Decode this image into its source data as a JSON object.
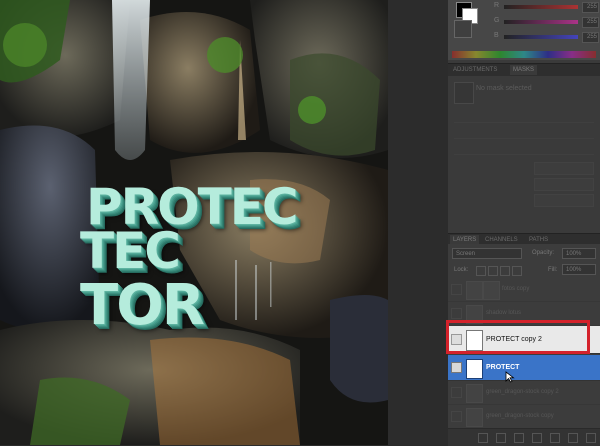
{
  "color_panel": {
    "channels": [
      {
        "label": "R",
        "value": "255",
        "color": "#c44"
      },
      {
        "label": "G",
        "value": "255",
        "color": "#b5a"
      },
      {
        "label": "B",
        "value": "255",
        "color": "#55c"
      }
    ]
  },
  "masks_panel": {
    "tabs": [
      "ADJUSTMENTS",
      "MASKS"
    ],
    "status": "No mask selected"
  },
  "layers_panel": {
    "tabs": [
      "LAYERS",
      "CHANNELS",
      "PATHS"
    ],
    "blend_mode": "Screen",
    "opacity_label": "Opacity:",
    "opacity_value": "100%",
    "lock_label": "Lock:",
    "fill_label": "Fill:",
    "fill_value": "100%",
    "layers": [
      {
        "name": "fotos copy"
      },
      {
        "name": "shadow lotus"
      },
      {
        "name": "PROTECT copy 2"
      },
      {
        "name": "PROTECT"
      },
      {
        "name": "green_dragon-stock copy 2"
      },
      {
        "name": "green_dragon-stock copy"
      }
    ]
  },
  "canvas": {
    "text_line_1": "PROTEC",
    "text_line_2": "TEC",
    "text_line_3": "TOR"
  }
}
